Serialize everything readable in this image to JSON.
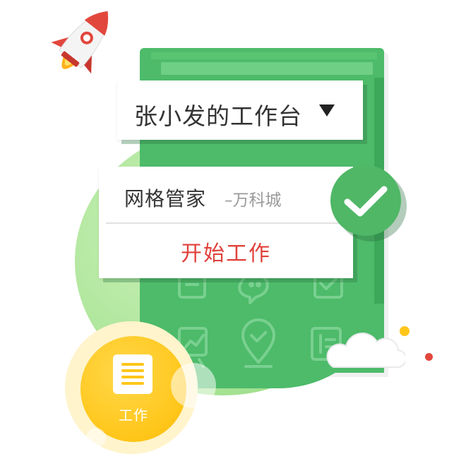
{
  "workspace": {
    "title": "张小发的工作台"
  },
  "card": {
    "role": "网格管家",
    "site": "–万科城",
    "start_label": "开始工作"
  },
  "work_badge": {
    "label": "工作"
  },
  "icons": {
    "rocket": "rocket-icon",
    "dropdown": "triangle-down-icon",
    "check": "check-icon",
    "document": "document-icon",
    "cloud": "cloud-icon"
  },
  "colors": {
    "board_green": "#4dbb6a",
    "light_green": "#a7e394",
    "accent_red": "#e0403a",
    "yellow": "#ffc61a",
    "check_green": "#4fb766"
  }
}
